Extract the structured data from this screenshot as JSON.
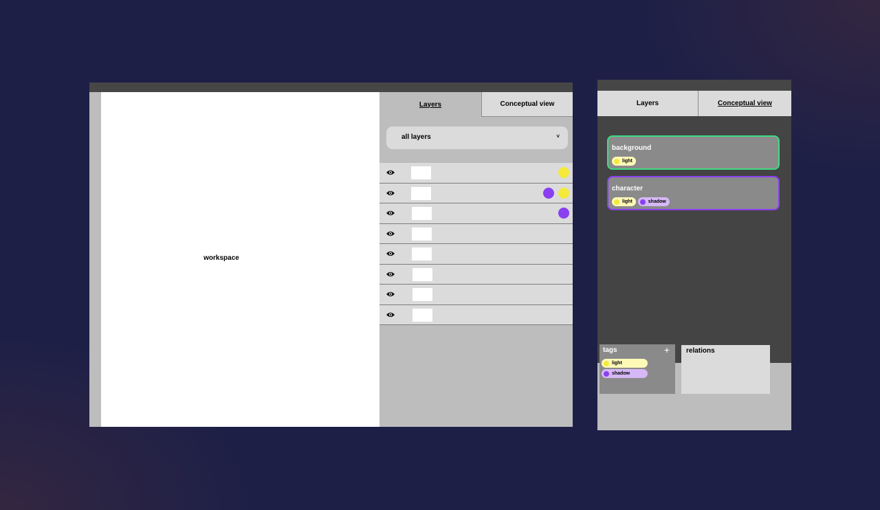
{
  "workspace": {
    "label": "workspace"
  },
  "tabs": {
    "layers": "Layers",
    "conceptual": "Conceptual view"
  },
  "layers_panel": {
    "filter": {
      "selected": "all layers",
      "chevron": "˅"
    },
    "rows": [
      {
        "thumb": "white",
        "tags": [
          "light"
        ]
      },
      {
        "thumb": "white",
        "tags": [
          "shadow",
          "light"
        ]
      },
      {
        "thumb": "white",
        "tags": [
          "shadow"
        ]
      },
      {
        "thumb": "white",
        "tags": []
      },
      {
        "thumb": "white",
        "tags": []
      },
      {
        "thumb": "white",
        "tags": []
      },
      {
        "thumb": "white",
        "tags": []
      },
      {
        "thumb": "white",
        "tags": []
      }
    ]
  },
  "conceptual_panel": {
    "nodes": [
      {
        "title": "background",
        "border_color": "#3ddc84",
        "tags": [
          "light"
        ]
      },
      {
        "title": "character",
        "border_color": "#8a3ff0",
        "tags": [
          "light",
          "shadow"
        ]
      }
    ],
    "tags_box": {
      "title": "tags",
      "add": "+",
      "items": [
        "light",
        "shadow"
      ]
    },
    "relations_box": {
      "title": "relations"
    }
  },
  "tag_styles": {
    "light": {
      "label": "light",
      "dot": "#f5e93b",
      "bg": "#fff9b8"
    },
    "shadow": {
      "label": "shadow",
      "dot": "#8a3ff0",
      "bg": "#d5b8f5"
    }
  },
  "icons": {
    "visibility": "eye-icon",
    "add": "plus-icon"
  }
}
